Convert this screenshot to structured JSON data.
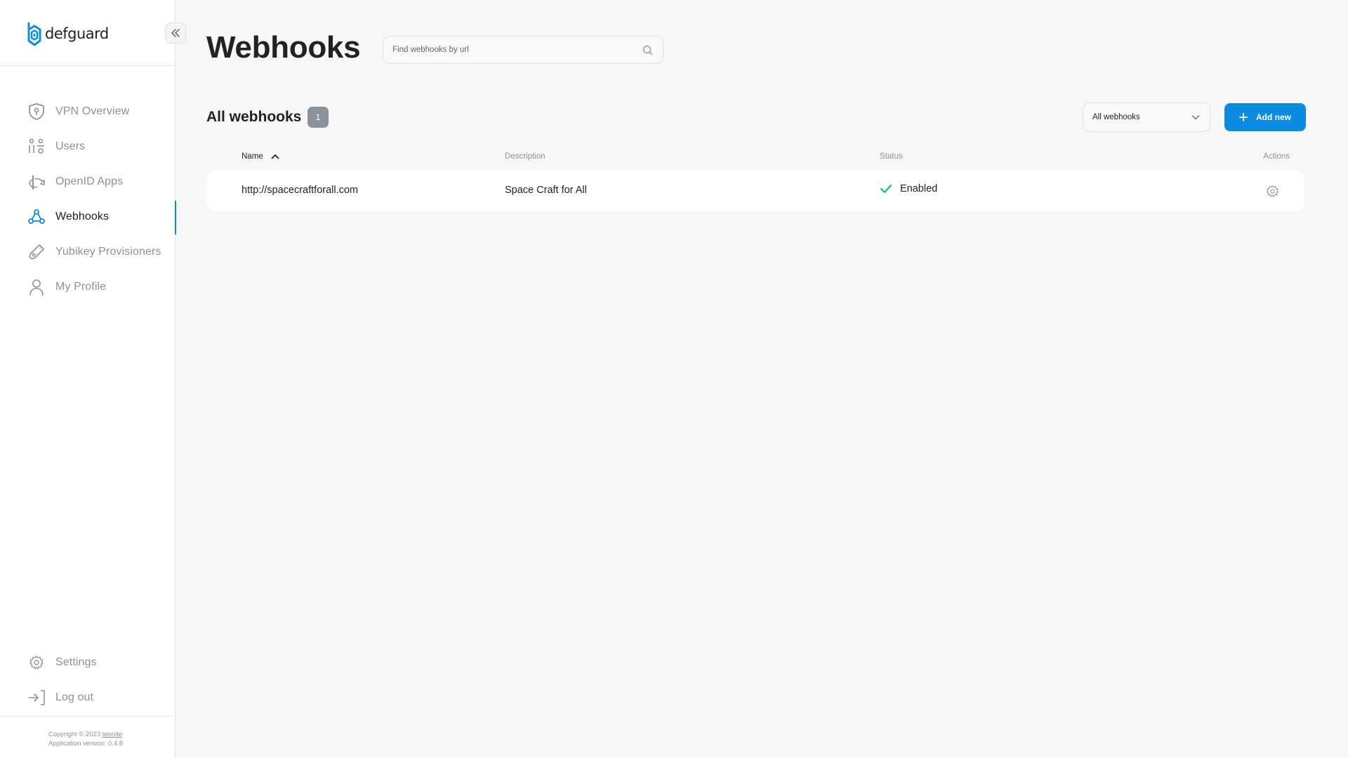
{
  "app": {
    "logo_text": "defguard"
  },
  "sidebar": {
    "items": [
      {
        "label": "VPN Overview",
        "icon": "shield-icon"
      },
      {
        "label": "Users",
        "icon": "users-icon"
      },
      {
        "label": "OpenID Apps",
        "icon": "openid-icon"
      },
      {
        "label": "Webhooks",
        "icon": "webhook-icon",
        "active": true
      },
      {
        "label": "Yubikey Provisioners",
        "icon": "yubikey-icon"
      },
      {
        "label": "My Profile",
        "icon": "profile-icon"
      }
    ],
    "bottom_items": [
      {
        "label": "Settings",
        "icon": "gear-icon"
      },
      {
        "label": "Log out",
        "icon": "logout-icon"
      }
    ],
    "footer": {
      "copyright_prefix": "Copyright © 2023",
      "company": "teonite",
      "version": "Application version: 0.4.8"
    }
  },
  "header": {
    "title": "Webhooks",
    "search_placeholder": "Find webhooks by url"
  },
  "section": {
    "title": "All webhooks",
    "count": "1",
    "filter_value": "All webhooks",
    "add_button_label": "Add new"
  },
  "table": {
    "columns": {
      "name": "Name",
      "description": "Description",
      "status": "Status",
      "actions": "Actions"
    },
    "sort": {
      "column": "name",
      "direction": "ascending"
    },
    "rows": [
      {
        "name": "http://spacecraftforall.com",
        "description": "Space Craft for All",
        "status": "Enabled"
      }
    ]
  },
  "colors": {
    "accent": "#0c8ce0",
    "enabled": "#14bc6e",
    "muted": "#8a939b"
  }
}
